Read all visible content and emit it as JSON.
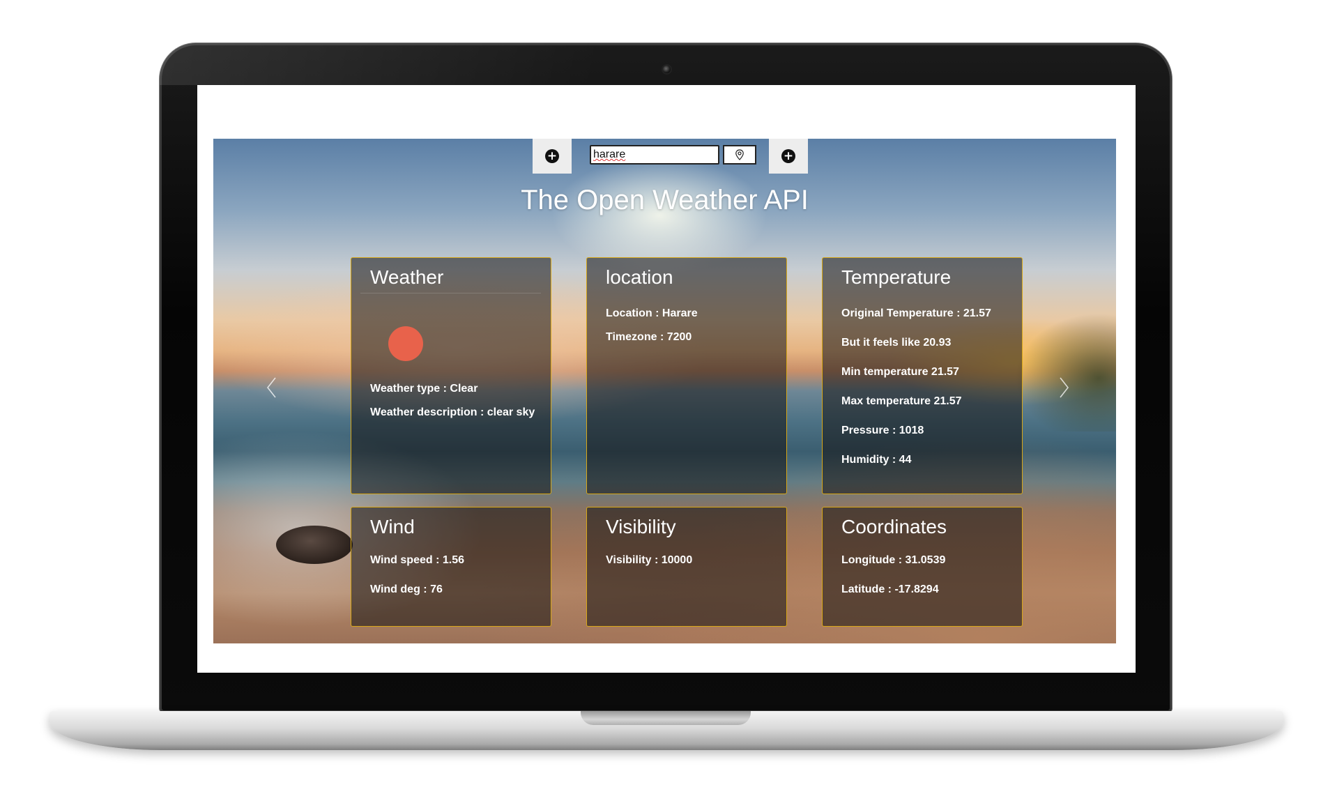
{
  "app": {
    "title": "The Open Weather API",
    "search": {
      "value": "harare"
    },
    "buttons": {
      "add_left": "+",
      "add_right": "+"
    },
    "icons": {
      "add": "plus-circle-icon",
      "locate": "map-pin-icon",
      "prev": "chevron-left-icon",
      "next": "chevron-right-icon",
      "weather": "sun-icon"
    },
    "colors": {
      "card_border": "#d8a818",
      "sun": "#e8624b"
    }
  },
  "cards": {
    "weather": {
      "title": "Weather",
      "type": "Weather type : Clear",
      "description": "Weather description : clear sky"
    },
    "location": {
      "title": "location",
      "location": "Location : Harare",
      "timezone": "Timezone : 7200"
    },
    "temperature": {
      "title": "Temperature",
      "original": "Original Temperature : 21.57",
      "feels_like": "But it feels like 20.93",
      "min": "Min temperature 21.57",
      "max": "Max temperature 21.57",
      "pressure": "Pressure : 1018",
      "humidity": "Humidity : 44"
    },
    "wind": {
      "title": "Wind",
      "speed": "Wind speed : 1.56",
      "deg": "Wind deg : 76"
    },
    "visibility": {
      "title": "Visibility",
      "value": "Visibility : 10000"
    },
    "coordinates": {
      "title": "Coordinates",
      "longitude": "Longitude : 31.0539",
      "latitude": "Latitude : -17.8294"
    }
  }
}
